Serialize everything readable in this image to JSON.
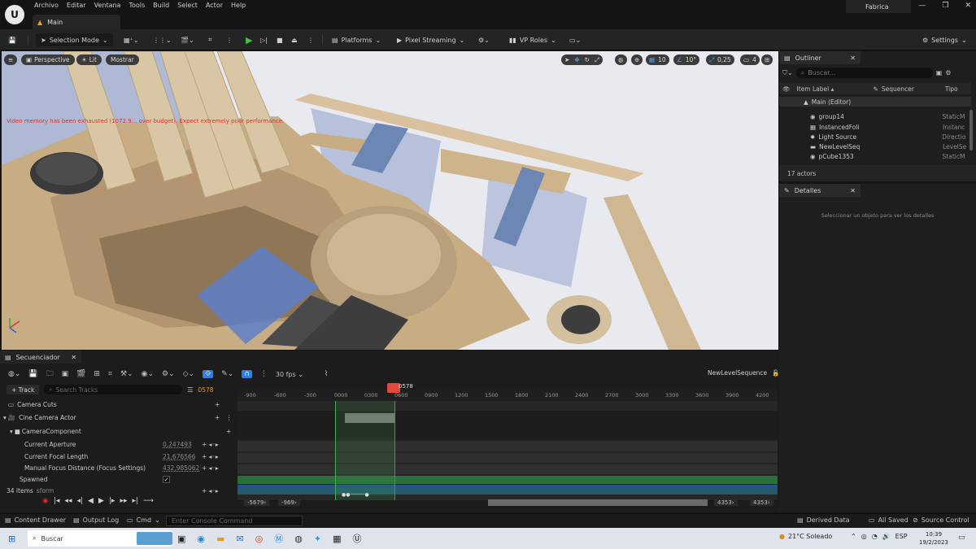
{
  "menubar": {
    "items": [
      "Archivo",
      "Editar",
      "Ventana",
      "Tools",
      "Build",
      "Select",
      "Actor",
      "Help"
    ],
    "tab": "Main",
    "project": "Fabrica"
  },
  "toolbar": {
    "selection_mode": "Selection Mode",
    "platforms": "Platforms",
    "pixel_streaming": "Pixel Streaming",
    "vp_roles": "VP Roles",
    "settings": "Settings"
  },
  "viewport": {
    "perspective": "Perspective",
    "lit": "Lit",
    "show": "Mostrar",
    "warning": "Video memory has been exhausted (1072.9... over budget). Expect extremely poor performance.",
    "grid_snap": "10",
    "rot_snap": "10°",
    "scale_snap": "0,25",
    "cam_speed": "4"
  },
  "outliner": {
    "title": "Outliner",
    "search_placeholder": "Buscar...",
    "col_label": "Item Label ▴",
    "col_sequencer": "Sequencer",
    "col_type": "Tipo",
    "root": "Main (Editor)",
    "rows": [
      {
        "label": "group14",
        "type": "StaticM"
      },
      {
        "label": "InstancedFoli",
        "type": "Instanc"
      },
      {
        "label": "Light Source",
        "type": "Directio"
      },
      {
        "label": "NewLevelSeq",
        "type": "LevelSe"
      },
      {
        "label": "pCube1353",
        "type": "StaticM"
      }
    ],
    "count": "17 actors"
  },
  "details": {
    "title": "Detalles",
    "empty": "Seleccionar un objeto para ver los detalles"
  },
  "sequencer": {
    "title": "Secuenciador",
    "add_track": "+ Track",
    "search_placeholder": "Search Tracks",
    "frame": "0578",
    "fps": "30 fps",
    "sequence_name": "NewLevelSequence",
    "tracks": [
      {
        "label": "Camera Cuts",
        "value": ""
      },
      {
        "label": "Cine Camera Actor",
        "value": ""
      },
      {
        "label": "CameraComponent",
        "value": ""
      },
      {
        "label": "Current Aperture",
        "value": "0,247493"
      },
      {
        "label": "Current Focal Length",
        "value": "21,676566"
      },
      {
        "label": "Manual Focus Distance (Focus Settings)",
        "value": "432,985062"
      },
      {
        "label": "Spawned",
        "value": ""
      }
    ],
    "items_count": "34 items",
    "partial_label": "sform",
    "ticks": [
      "-900",
      "-600",
      "-300",
      "0000",
      "0300",
      "0600",
      "0900",
      "1200",
      "1500",
      "1800",
      "2100",
      "2400",
      "2700",
      "3000",
      "3300",
      "3600",
      "3900",
      "4200"
    ],
    "playhead_label": "0578",
    "range_start": "-5679›",
    "range_in": "-969›",
    "range_out": "4353›",
    "range_end": "4353›"
  },
  "bottombar": {
    "content_drawer": "Content Drawer",
    "output_log": "Output Log",
    "cmd": "Cmd",
    "console_placeholder": "Enter Console Command",
    "derived_data": "Derived Data",
    "all_saved": "All Saved",
    "source_control": "Source Control"
  },
  "taskbar": {
    "search": "Buscar",
    "weather": "21°C  Soleado",
    "lang": "ESP",
    "time": "10:39",
    "date": "19/2/2023"
  }
}
